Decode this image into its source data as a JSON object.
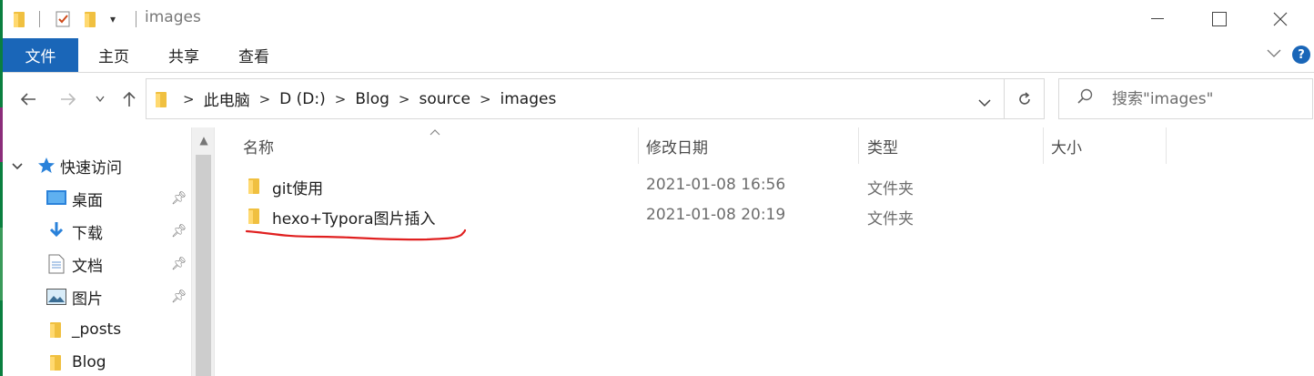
{
  "window": {
    "title": "images",
    "minimize_icon": "minimize-icon",
    "maximize_icon": "maximize-icon",
    "close_icon": "close-icon"
  },
  "ribbon": {
    "tabs": [
      {
        "label": "文件",
        "active": true
      },
      {
        "label": "主页"
      },
      {
        "label": "共享"
      },
      {
        "label": "查看"
      }
    ],
    "help_label": "?"
  },
  "address": {
    "breadcrumbs": [
      "此电脑",
      "D (D:)",
      "Blog",
      "source",
      "images"
    ]
  },
  "search": {
    "placeholder": "搜索\"images\""
  },
  "nav_pane": {
    "quick_access_label": "快速访问",
    "items": [
      {
        "label": "桌面",
        "icon": "desktop-icon",
        "pinned": true
      },
      {
        "label": "下载",
        "icon": "download-icon",
        "pinned": true
      },
      {
        "label": "文档",
        "icon": "document-icon",
        "pinned": true
      },
      {
        "label": "图片",
        "icon": "pictures-icon",
        "pinned": true
      },
      {
        "label": "_posts",
        "icon": "folder-icon",
        "pinned": false
      },
      {
        "label": "Blog",
        "icon": "folder-icon",
        "pinned": false
      }
    ]
  },
  "columns": {
    "name": "名称",
    "date": "修改日期",
    "type": "类型",
    "size": "大小"
  },
  "files": [
    {
      "name": "git使用",
      "date": "2021-01-08 16:56",
      "type": "文件夹"
    },
    {
      "name": "hexo+Typora图片插入",
      "date": "2021-01-08 20:19",
      "type": "文件夹"
    }
  ],
  "colors": {
    "accent": "#1a66b8",
    "folder": "#f0c040",
    "annotation_red": "#e02020"
  }
}
